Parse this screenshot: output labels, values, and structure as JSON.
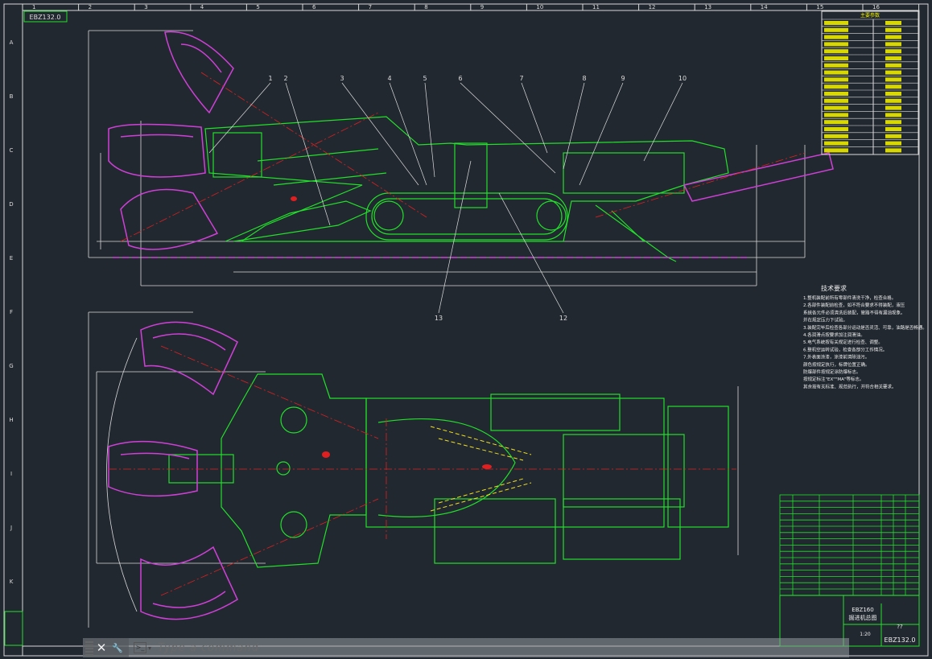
{
  "drawing": {
    "tag_label": "EBZ132.0",
    "columns": [
      "1",
      "2",
      "3",
      "4",
      "5",
      "6",
      "7",
      "8",
      "9",
      "10",
      "11",
      "12",
      "13",
      "14",
      "15",
      "16"
    ],
    "rows": [
      "A",
      "B",
      "C",
      "D",
      "E",
      "F",
      "G",
      "H",
      "I",
      "J",
      "K"
    ],
    "callouts": [
      "1",
      "2",
      "3",
      "4",
      "5",
      "6",
      "7",
      "8",
      "9",
      "10",
      "13",
      "12"
    ],
    "notes_title": "技术要求",
    "notes": [
      "1.整机装配前所有零部件清洗干净，检查合格。",
      "2.各部件装配前检查，如不符合要求不得装配，液压",
      "  系统各元件必须清洗后装配，管路不得有漏油现象。",
      "  并在规定压力下试验。",
      "3.装配完毕后检查各部分运动是否灵活、可靠，油路是否畅通。",
      "4.各润滑点按要求加注润滑油。",
      "5.电气系统按有关规定进行检查、调整。",
      "6.整机空运转试验，检查各部分工作情况。",
      "7.外表面涂漆，涂漆前清除油污。",
      "  颜色按规定执行，标牌位置正确。",
      "  防爆部件按规定涂防爆标志。",
      "  按规定标注\"EX\"\"MA\"等标志。",
      "  其余按有关标准、规范执行，并符合相关要求。"
    ],
    "params_title": "主要参数",
    "title_block": {
      "name_line1": "EBZ160",
      "name_line2": "掘进机总图",
      "drawing_number": "EBZ132.0",
      "scale": "1:20",
      "sheet": "??"
    }
  },
  "command_line": {
    "placeholder": "Type a command",
    "close_label": "✕",
    "customize_label": "🔧",
    "prompt_label": ">_"
  },
  "colors": {
    "background": "#212830",
    "machine": "#22e02a",
    "cutter": "#d040d8",
    "dimension": "#e8e8e8",
    "center": "#e02020",
    "table_text": "#f0f000"
  }
}
